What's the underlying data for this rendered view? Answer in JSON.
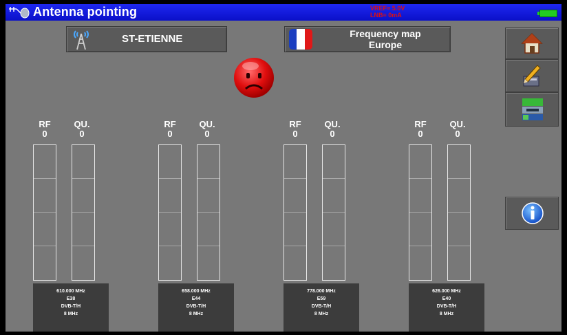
{
  "title": "Antenna pointing",
  "status": {
    "line1": "VREF= 5.0V",
    "line2": "LNB= 0mA"
  },
  "site": {
    "label": "ST-ETIENNE",
    "icon": "antenna-tower-icon"
  },
  "frequency_map": {
    "line1": "Frequency map",
    "line2": "Europe",
    "icon": "france-flag-icon"
  },
  "signal_indicator": {
    "icon": "sad-face-icon",
    "color": "#e01010"
  },
  "side_buttons": [
    {
      "name": "home-button",
      "icon": "home-icon"
    },
    {
      "name": "edit-button",
      "icon": "pencil-icon"
    },
    {
      "name": "settings-button",
      "icon": "installation-icon"
    },
    {
      "name": "info-button",
      "icon": "info-icon"
    }
  ],
  "meters": [
    {
      "rf_label": "RF",
      "rf_value": "0",
      "qu_label": "QU.",
      "qu_value": "0",
      "frequency": "610.000 MHz",
      "channel": "E38",
      "standard": "DVB-T/H",
      "bandwidth": "8 MHz"
    },
    {
      "rf_label": "RF",
      "rf_value": "0",
      "qu_label": "QU.",
      "qu_value": "0",
      "frequency": "658.000 MHz",
      "channel": "E44",
      "standard": "DVB-T/H",
      "bandwidth": "8 MHz"
    },
    {
      "rf_label": "RF",
      "rf_value": "0",
      "qu_label": "QU.",
      "qu_value": "0",
      "frequency": "778.000 MHz",
      "channel": "E59",
      "standard": "DVB-T/H",
      "bandwidth": "8 MHz"
    },
    {
      "rf_label": "RF",
      "rf_value": "0",
      "qu_label": "QU.",
      "qu_value": "0",
      "frequency": "626.000 MHz",
      "channel": "E40",
      "standard": "DVB-T/H",
      "bandwidth": "8 MHz"
    }
  ]
}
